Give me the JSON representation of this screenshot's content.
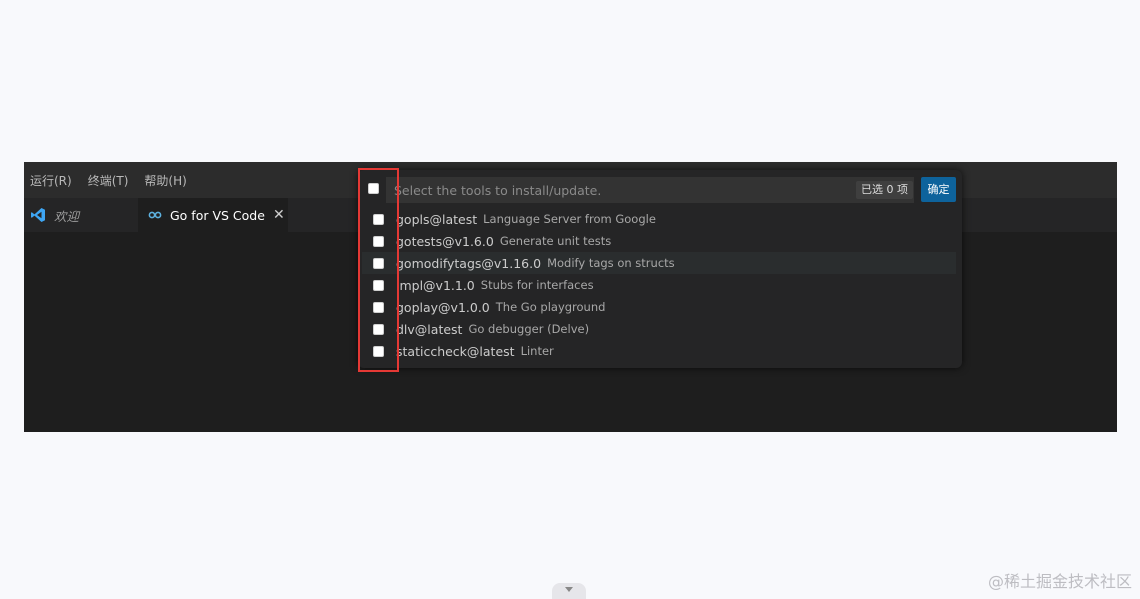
{
  "menubar": {
    "items": [
      "运行(R)",
      "终端(T)",
      "帮助(H)"
    ]
  },
  "tabs": [
    {
      "label": "欢迎",
      "icon": "vscode-logo-icon",
      "active": false
    },
    {
      "label": "Go for VS Code",
      "icon": "go-extension-icon",
      "active": true
    }
  ],
  "quickpick": {
    "placeholder": "Select the tools to install/update.",
    "count_badge": "已选 0 项",
    "ok_label": "确定",
    "items": [
      {
        "label": "gopls@latest",
        "description": "Language Server from Google",
        "checked": false
      },
      {
        "label": "gotests@v1.6.0",
        "description": "Generate unit tests",
        "checked": false
      },
      {
        "label": "gomodifytags@v1.16.0",
        "description": "Modify tags on structs",
        "checked": false
      },
      {
        "label": "impl@v1.1.0",
        "description": "Stubs for interfaces",
        "checked": false
      },
      {
        "label": "goplay@v1.0.0",
        "description": "The Go playground",
        "checked": false
      },
      {
        "label": "dlv@latest",
        "description": "Go debugger (Delve)",
        "checked": false
      },
      {
        "label": "staticcheck@latest",
        "description": "Linter",
        "checked": false
      }
    ]
  },
  "watermark": "@稀土掘金技术社区",
  "colors": {
    "accent": "#0e639c",
    "highlight": "#e53935",
    "go_icon": "#5db1df",
    "vscode_icon": "#3ea6f4"
  }
}
